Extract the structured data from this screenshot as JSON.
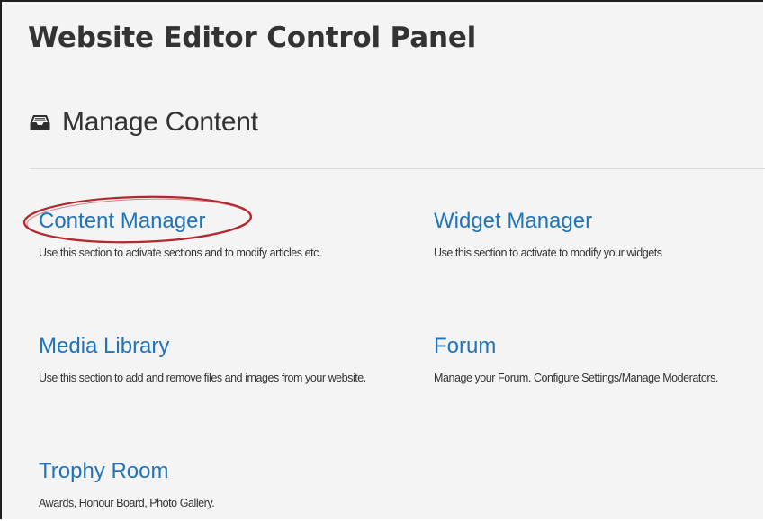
{
  "header": {
    "title": "Website Editor Control Panel"
  },
  "section": {
    "title": "Manage Content",
    "icon": "inbox-icon"
  },
  "items": [
    {
      "label": "Content Manager",
      "description": "Use this section to activate sections and to modify articles etc.",
      "highlighted": true
    },
    {
      "label": "Widget Manager",
      "description": "Use this section to activate to modify your widgets"
    },
    {
      "label": "Media Library",
      "description": "Use this section to add and remove files and images from your website."
    },
    {
      "label": "Forum",
      "description": "Manage your Forum. Configure Settings/Manage Moderators."
    },
    {
      "label": "Trophy Room",
      "description": "Awards, Honour Board, Photo Gallery."
    }
  ],
  "colors": {
    "link": "#2174ba",
    "heading": "#333333",
    "highlight_ring": "#b3282d",
    "background": "#f4f4f4"
  }
}
